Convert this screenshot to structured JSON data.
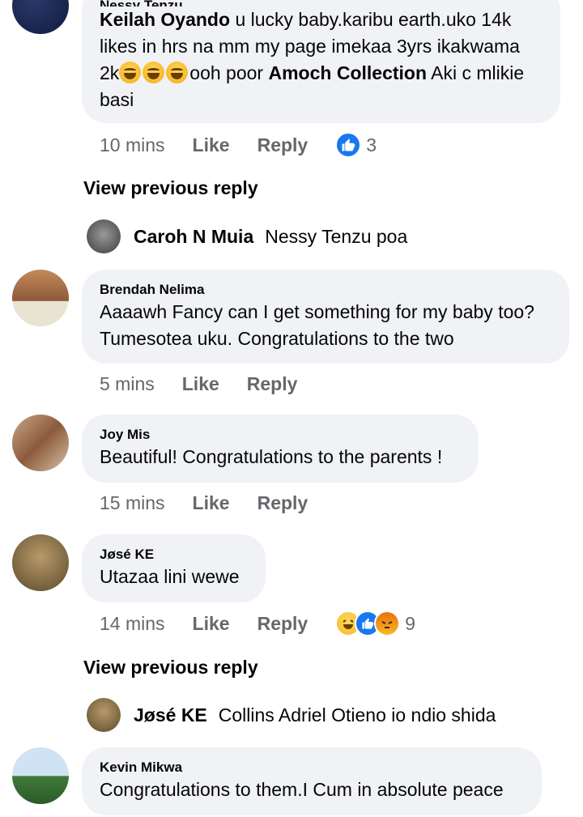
{
  "comments": [
    {
      "author": "Nessy Tenzu",
      "text_before": "u lucky baby.karibu earth.uko 14k likes in hrs na mm my page imekaa 3yrs ikakwama 2k",
      "text_after": "ooh poor",
      "tagged_name": "Amoch Collection",
      "text_end": "Aki c mlikie basi",
      "inline_tag": "Keilah Oyando",
      "time": "10 mins",
      "like": "Like",
      "reply": "Reply",
      "reaction_count": "3"
    },
    {
      "author": "Brendah Nelima",
      "text": "Aaaawh Fancy can I get something for my baby too? Tumesotea uku. Congratulations to the two",
      "time": "5 mins",
      "like": "Like",
      "reply": "Reply"
    },
    {
      "author": "Joy Mis",
      "text": "Beautiful! Congratulations to the parents !",
      "time": "15 mins",
      "like": "Like",
      "reply": "Reply"
    },
    {
      "author": "Jøsé KE",
      "text": "Utazaa lini wewe",
      "time": "14 mins",
      "like": "Like",
      "reply": "Reply",
      "reaction_count": "9"
    },
    {
      "author": "Kevin Mikwa",
      "text": "Congratulations to them.I Cum in absolute peace"
    }
  ],
  "view_previous_reply": "View previous reply",
  "replies": [
    {
      "name": "Caroh N Muia",
      "text": "Nessy Tenzu poa"
    },
    {
      "name": "Jøsé KE",
      "text": "Collins Adriel Otieno io ndio shida"
    }
  ],
  "colors": {
    "bubble": "#f0f2f5",
    "meta_gray": "#65676b",
    "like_blue": "#1877f2"
  }
}
